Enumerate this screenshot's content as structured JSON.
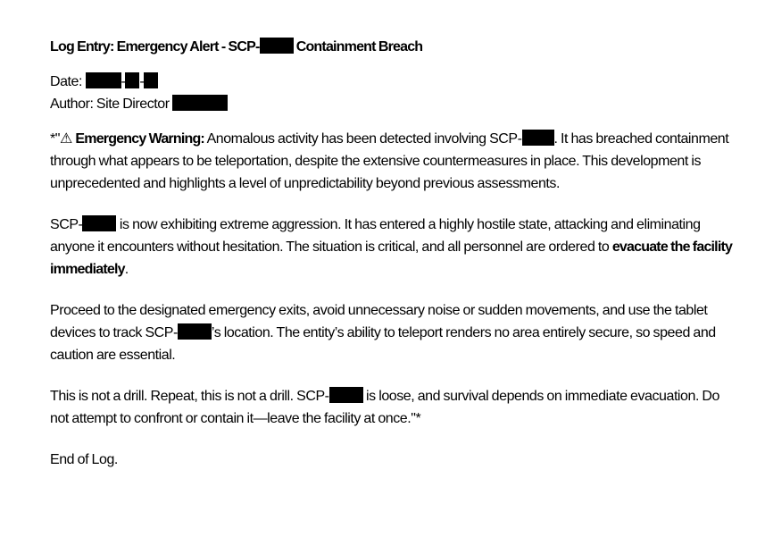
{
  "title": {
    "prefix": "Log Entry: Emergency Alert - SCP-",
    "suffix": " Containment Breach"
  },
  "meta": {
    "date_label": "Date: ",
    "date_sep": "-",
    "author_label": "Author: Site Director "
  },
  "p1": {
    "lead": "*\"⚠ ",
    "warning": "Emergency Warning:",
    "text1": " Anomalous activity has been detected involving SCP-",
    "text2": ". It has breached containment through what appears to be teleportation, despite the extensive countermeasures in place. This development is unprecedented and highlights a level of unpredictability beyond previous assessments."
  },
  "p2": {
    "text1": "SCP-",
    "text2": " is now exhibiting extreme aggression. It has entered a highly hostile state, attacking and eliminating anyone it encounters without hesitation. The situation is critical, and all personnel are ordered to ",
    "emphasis": "evacuate the facility immediately",
    "text3": "."
  },
  "p3": {
    "text1": "Proceed to the designated emergency exits, avoid unnecessary noise or sudden movements, and use the tablet devices to track SCP-",
    "text2": "’s location. The entity’s ability to teleport renders no area entirely secure, so speed and caution are essential."
  },
  "p4": {
    "text1": "This is not a drill. Repeat, this is not a drill. SCP-",
    "text2": " is loose, and survival depends on immediate evacuation. Do not attempt to confront or contain it—leave the facility at once.\"*"
  },
  "end": "End of Log."
}
